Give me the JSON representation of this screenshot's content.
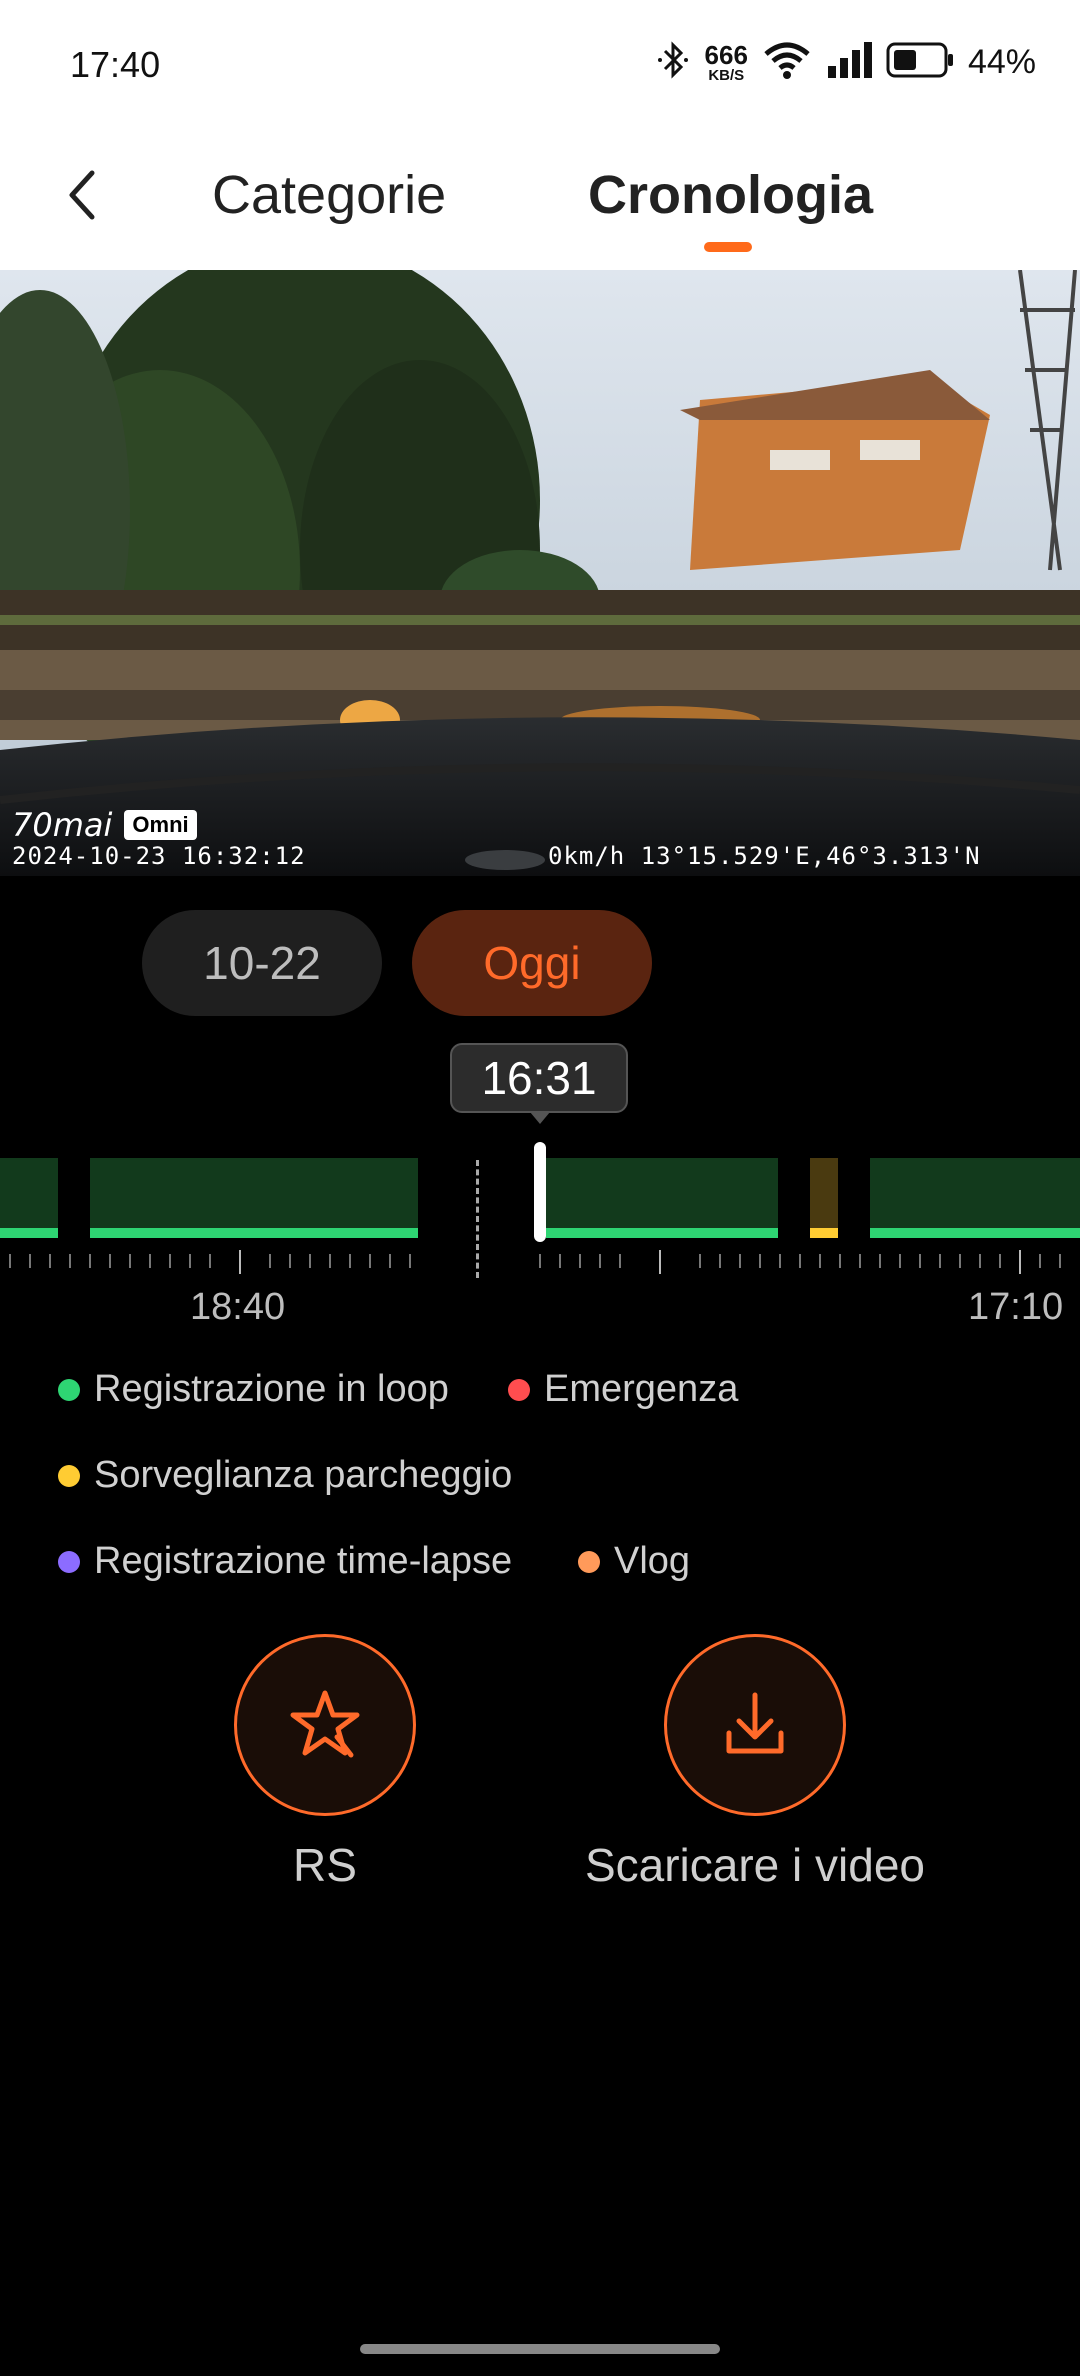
{
  "status_bar": {
    "time": "17:40",
    "net_speed": "666",
    "net_unit": "KB/S",
    "battery": "44%"
  },
  "header": {
    "tabs": [
      {
        "label": "Categorie"
      },
      {
        "label": "Cronologia",
        "active": true
      }
    ]
  },
  "video": {
    "brand": "70mai",
    "model_badge": "Omni",
    "timestamp": "2024-10-23 16:32:12",
    "gps": "0km/h 13°15.529'E,46°3.313'N"
  },
  "dates": {
    "previous": "10-22",
    "today": "Oggi"
  },
  "timeline": {
    "current_time": "16:31",
    "labels": [
      "18:40",
      "17:10"
    ]
  },
  "legend": [
    {
      "label": "Registrazione in loop",
      "color": "#2ed573"
    },
    {
      "label": "Emergenza",
      "color": "#ff4d4f"
    },
    {
      "label": "Sorveglianza parcheggio",
      "color": "#ffcc33"
    },
    {
      "label": "Registrazione time-lapse",
      "color": "#8c6cff"
    },
    {
      "label": "Vlog",
      "color": "#ff9a5a"
    }
  ],
  "actions": {
    "rs": "RS",
    "download": "Scaricare i video"
  },
  "colors": {
    "accent": "#ff6a2a",
    "loop_green": "#2ed573",
    "parking_yellow": "#ffcc33"
  }
}
